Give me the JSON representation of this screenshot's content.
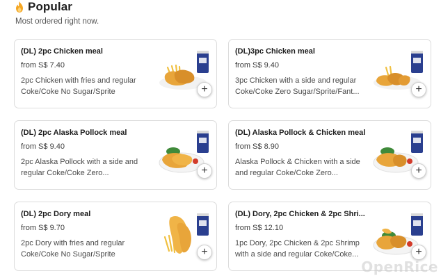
{
  "section": {
    "title": "Popular",
    "subtitle": "Most ordered right now.",
    "icon": "flame-icon"
  },
  "items": [
    {
      "name": "(DL) 2pc Chicken meal",
      "price": "from S$ 7.40",
      "desc": "2pc Chicken with fries and regular Coke/Coke No Sugar/Sprite"
    },
    {
      "name": "(DL)3pc Chicken meal",
      "price": "from S$ 9.40",
      "desc": "3pc Chicken with a side and regular Coke/Coke Zero Sugar/Sprite/Fant..."
    },
    {
      "name": "(DL) 2pc Alaska Pollock meal",
      "price": "from S$ 9.40",
      "desc": "2pc Alaska Pollock with a side and regular Coke/Coke Zero..."
    },
    {
      "name": "(DL) Alaska Pollock & Chicken meal",
      "price": "from S$ 8.90",
      "desc": "Alaska Pollock & Chicken with a side and regular Coke/Coke Zero..."
    },
    {
      "name": "(DL) 2pc Dory meal",
      "price": "from S$ 9.70",
      "desc": "2pc Dory with fries and regular Coke/Coke No Sugar/Sprite"
    },
    {
      "name": "(DL) Dory, 2pc Chicken & 2pc Shri...",
      "price": "from S$ 12.10",
      "desc": "1pc Dory, 2pc Chicken & 2pc Shrimp with a side and regular Coke/Coke..."
    }
  ],
  "add_label": "+",
  "watermark": "OpenRice",
  "colors": {
    "flame": "#f5a623",
    "fried": "#e8a53a",
    "cup": "#2a3f8f"
  }
}
